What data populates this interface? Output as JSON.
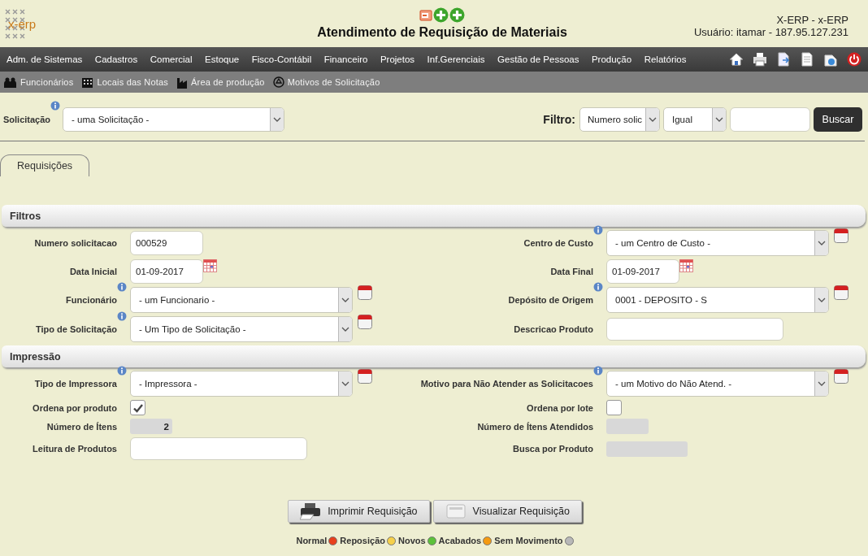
{
  "header": {
    "logo_text": "x-erp",
    "title": "Atendimento de Requisição de Materiais",
    "system": "X-ERP - x-ERP",
    "user": "Usuário: itamar - 187.95.127.231"
  },
  "menu": [
    "Adm. de Sistemas",
    "Cadastros",
    "Comercial",
    "Estoque",
    "Fisco-Contábil",
    "Financeiro",
    "Projetos",
    "Inf.Gerenciais",
    "Gestão de Pessoas",
    "Produção",
    "Relatórios"
  ],
  "submenu": [
    "Funcionários",
    "Locais das Notas",
    "Área de produção",
    "Motivos de Solicitação"
  ],
  "solicitacao": {
    "label": "Solicitação",
    "value": "- uma Solicitação -"
  },
  "filter": {
    "label": "Filtro:",
    "field": "Numero solic",
    "operator": "Igual",
    "button": "Buscar"
  },
  "tabs": [
    {
      "label": "Requisições",
      "selected": true
    }
  ],
  "sections": [
    {
      "title": "Filtros",
      "rows": [
        {
          "left": {
            "label": "Numero solicitacao",
            "kind": "number",
            "value": "000529",
            "info": false,
            "lookup": false
          },
          "right": {
            "label": "Centro de Custo",
            "kind": "select",
            "value": "- um Centro de Custo -",
            "info": true,
            "lookup": true
          }
        },
        {
          "left": {
            "label": "Data Inicial",
            "kind": "date",
            "value": "01-09-2017",
            "info": false,
            "lookup": false
          },
          "right": {
            "label": "Data Final",
            "kind": "date",
            "value": "01-09-2017",
            "info": false,
            "lookup": false
          }
        },
        {
          "left": {
            "label": "Funcionário",
            "kind": "select",
            "value": "- um Funcionario -",
            "info": true,
            "lookup": true
          },
          "right": {
            "label": "Depósito de Origem",
            "kind": "select",
            "value": "0001 - DEPOSITO - S",
            "info": true,
            "lookup": true
          }
        },
        {
          "left": {
            "label": "Tipo de Solicitação",
            "kind": "select",
            "value": "- Um Tipo de Solicitação -",
            "info": true,
            "lookup": true
          },
          "right": {
            "label": "Descricao Produto",
            "kind": "text",
            "info": false,
            "lookup": false
          }
        }
      ]
    },
    {
      "title": "Impressão",
      "rows": [
        {
          "left": {
            "label": "Tipo de Impressora",
            "kind": "select",
            "value": "- Impressora -",
            "info": true,
            "lookup": true
          },
          "right": {
            "label": "Motivo para Não Atender as Solicitacoes",
            "kind": "select",
            "value": "- um Motivo do Não Atend. -",
            "info": true,
            "lookup": true
          }
        },
        {
          "left": {
            "label": "Ordena por produto",
            "kind": "checkbox",
            "checked": true,
            "info": false,
            "lookup": false
          },
          "right": {
            "label": "Ordena por lote",
            "kind": "checkbox",
            "checked": false,
            "info": false,
            "lookup": false
          }
        },
        {
          "left": {
            "label": "Número de Ítens",
            "kind": "count",
            "value": "2",
            "info": false,
            "lookup": false
          },
          "right": {
            "label": "Número de Ítens Atendidos",
            "kind": "count",
            "info": false,
            "lookup": false
          }
        },
        {
          "left": {
            "label": "Leitura de Produtos",
            "kind": "text",
            "info": false,
            "lookup": false
          },
          "right": {
            "label": "Busca por Produto",
            "kind": "readonly",
            "info": false,
            "lookup": false
          }
        }
      ]
    }
  ],
  "buttons": [
    {
      "label": "Imprimir Requisição",
      "kind": "print"
    },
    {
      "label": "Visualizar Requisição",
      "kind": "preview"
    }
  ],
  "legend": [
    {
      "label": "Normal",
      "color": "#e8401c"
    },
    {
      "label": "Reposição",
      "color": "#f5d04a"
    },
    {
      "label": "Novos",
      "color": "#5cc23a"
    },
    {
      "label": "Acabados",
      "color": "#f59a10"
    },
    {
      "label": "Sem Movimento",
      "color": "#b8b8b8"
    }
  ]
}
